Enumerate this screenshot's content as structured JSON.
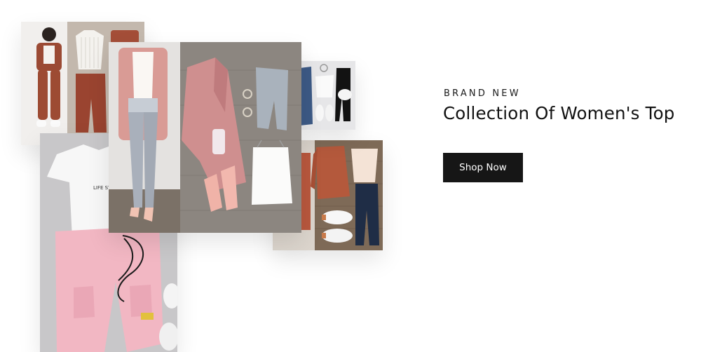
{
  "promo": {
    "eyebrow": "BRAND NEW",
    "headline": "Collection Of Women's Top",
    "cta_label": "Shop Now"
  },
  "collage": {
    "images": [
      {
        "name": "rust-cargo-outfit-photo"
      },
      {
        "name": "pink-cargo-pants-flatlay-photo"
      },
      {
        "name": "brown-jacket-flatlay-photo"
      },
      {
        "name": "denim-sneakers-flatlay-photo"
      },
      {
        "name": "pink-blazer-outfit-photo"
      }
    ]
  },
  "colors": {
    "cta_background": "#161616",
    "cta_text": "#ffffff",
    "headline_text": "#111111",
    "page_background": "#ffffff"
  }
}
